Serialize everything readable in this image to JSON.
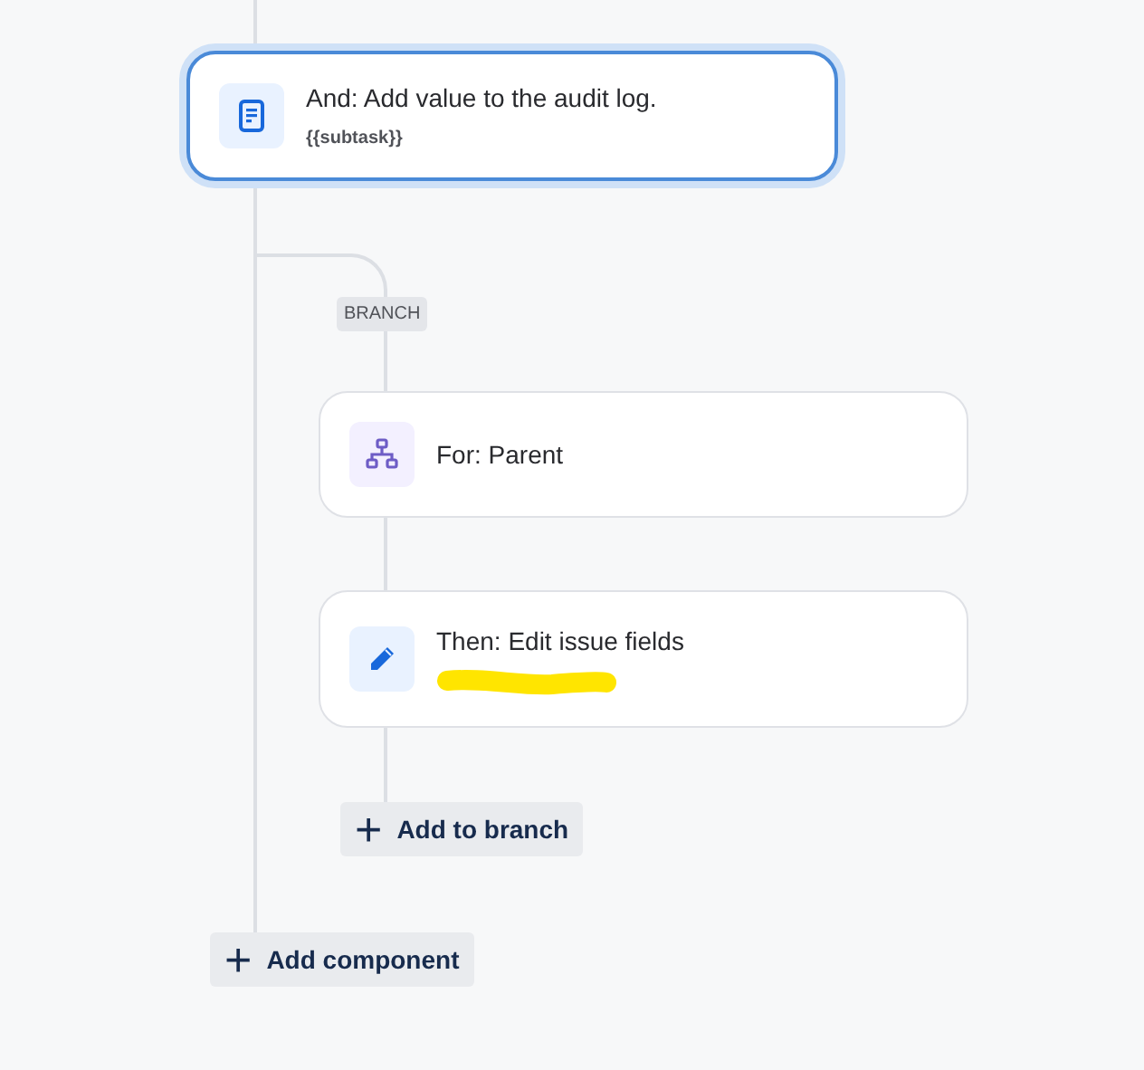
{
  "steps": [
    {
      "kind": "document",
      "title": "And: Add value to the audit log.",
      "subtitle": "{{subtask}}",
      "selected": true
    },
    {
      "kind": "branch",
      "title": "For: Parent",
      "selected": false
    },
    {
      "kind": "edit",
      "title": "Then: Edit issue fields",
      "selected": false,
      "redacted": true
    }
  ],
  "branch_label": "BRANCH",
  "add_to_branch": {
    "icon": "+",
    "label": "Add to branch"
  },
  "add_component": {
    "icon": "+",
    "label": "Add component"
  }
}
